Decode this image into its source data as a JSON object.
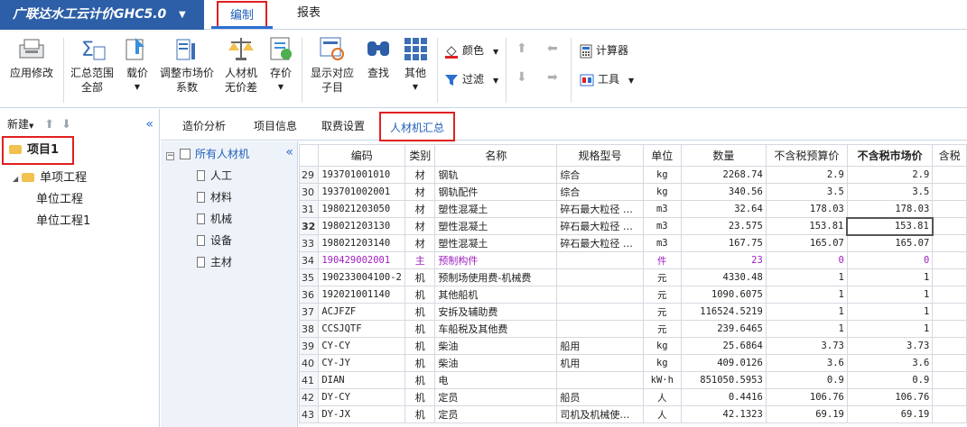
{
  "app": {
    "title": "广联达水工云计价GHC5.0",
    "menu": [
      "编制",
      "报表"
    ]
  },
  "ribbon": {
    "apply": "应用修改",
    "summary_range": [
      "汇总范围",
      "全部"
    ],
    "load_price": "载价",
    "adjust_price": [
      "调整市场价",
      "系数"
    ],
    "no_diff": [
      "人材机",
      "无价差"
    ],
    "save_price": "存价",
    "show_child": [
      "显示对应",
      "子目"
    ],
    "find": "查找",
    "other": "其他",
    "color": "颜色",
    "filter": "过滤",
    "calculator": "计算器",
    "tools": "工具"
  },
  "left": {
    "new": "新建",
    "project": "项目1",
    "sub": "单项工程",
    "unit1": "单位工程",
    "unit2": "单位工程1"
  },
  "tabs": [
    "造价分析",
    "项目信息",
    "取费设置",
    "人材机汇总"
  ],
  "mattree": {
    "root": "所有人材机",
    "items": [
      "人工",
      "材料",
      "机械",
      "设备",
      "主材"
    ]
  },
  "grid": {
    "headers": [
      "编码",
      "类别",
      "名称",
      "规格型号",
      "单位",
      "数量",
      "不含税预算价",
      "不含税市场价",
      "含税"
    ],
    "rows": [
      {
        "no": "29",
        "code": "193701001010",
        "cat": "材",
        "name": "钢轨",
        "spec": "综合",
        "unit": "kg",
        "qty": "2268.74",
        "budget": "2.9",
        "market": "2.9"
      },
      {
        "no": "30",
        "code": "193701002001",
        "cat": "材",
        "name": "钢轨配件",
        "spec": "综合",
        "unit": "kg",
        "qty": "340.56",
        "budget": "3.5",
        "market": "3.5"
      },
      {
        "no": "31",
        "code": "198021203050",
        "cat": "材",
        "name": "塑性混凝土",
        "spec": "碎石最大粒径 …",
        "unit": "m3",
        "qty": "32.64",
        "budget": "178.03",
        "market": "178.03"
      },
      {
        "no": "32",
        "code": "198021203130",
        "cat": "材",
        "name": "塑性混凝土",
        "spec": "碎石最大粒径 …",
        "unit": "m3",
        "qty": "23.575",
        "budget": "153.81",
        "market": "153.81"
      },
      {
        "no": "33",
        "code": "198021203140",
        "cat": "材",
        "name": "塑性混凝土",
        "spec": "碎石最大粒径 …",
        "unit": "m3",
        "qty": "167.75",
        "budget": "165.07",
        "market": "165.07"
      },
      {
        "no": "34",
        "code": "190429002001",
        "cat": "主",
        "name": "预制构件",
        "spec": "",
        "unit": "件",
        "qty": "23",
        "budget": "0",
        "market": "0"
      },
      {
        "no": "35",
        "code": "190233004100-2",
        "cat": "机",
        "name": "预制场使用费-机械费",
        "spec": "",
        "unit": "元",
        "qty": "4330.48",
        "budget": "1",
        "market": "1"
      },
      {
        "no": "36",
        "code": "192021001140",
        "cat": "机",
        "name": "其他船机",
        "spec": "",
        "unit": "元",
        "qty": "1090.6075",
        "budget": "1",
        "market": "1"
      },
      {
        "no": "37",
        "code": "ACJFZF",
        "cat": "机",
        "name": "安拆及辅助费",
        "spec": "",
        "unit": "元",
        "qty": "116524.5219",
        "budget": "1",
        "market": "1"
      },
      {
        "no": "38",
        "code": "CCSJQTF",
        "cat": "机",
        "name": "车船税及其他费",
        "spec": "",
        "unit": "元",
        "qty": "239.6465",
        "budget": "1",
        "market": "1"
      },
      {
        "no": "39",
        "code": "CY-CY",
        "cat": "机",
        "name": "柴油",
        "spec": "船用",
        "unit": "kg",
        "qty": "25.6864",
        "budget": "3.73",
        "market": "3.73"
      },
      {
        "no": "40",
        "code": "CY-JY",
        "cat": "机",
        "name": "柴油",
        "spec": "机用",
        "unit": "kg",
        "qty": "409.0126",
        "budget": "3.6",
        "market": "3.6"
      },
      {
        "no": "41",
        "code": "DIAN",
        "cat": "机",
        "name": "电",
        "spec": "",
        "unit": "kW·h",
        "qty": "851050.5953",
        "budget": "0.9",
        "market": "0.9"
      },
      {
        "no": "42",
        "code": "DY-CY",
        "cat": "机",
        "name": "定员",
        "spec": "船员",
        "unit": "人",
        "qty": "0.4416",
        "budget": "106.76",
        "market": "106.76"
      },
      {
        "no": "43",
        "code": "DY-JX",
        "cat": "机",
        "name": "定员",
        "spec": "司机及机械使…",
        "unit": "人",
        "qty": "42.1323",
        "budget": "69.19",
        "market": "69.19"
      }
    ]
  }
}
